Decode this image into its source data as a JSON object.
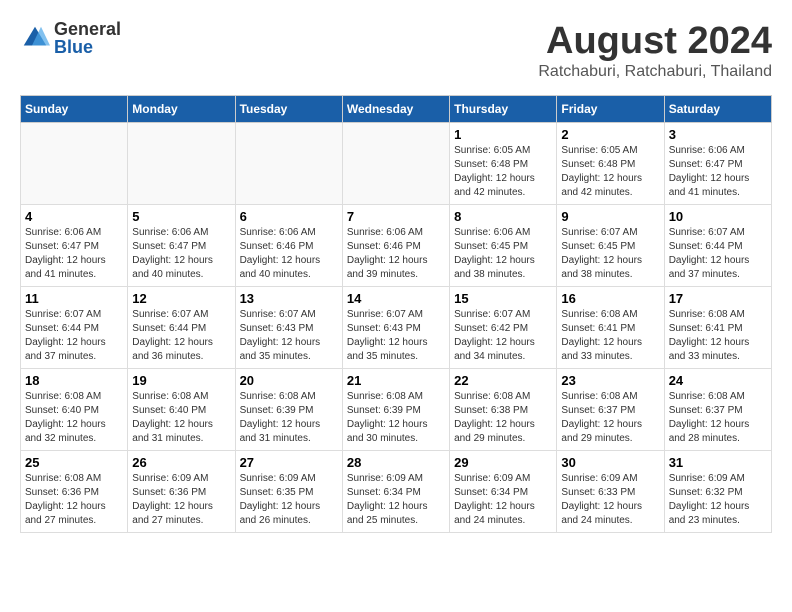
{
  "logo": {
    "general": "General",
    "blue": "Blue"
  },
  "title": "August 2024",
  "subtitle": "Ratchaburi, Ratchaburi, Thailand",
  "weekdays": [
    "Sunday",
    "Monday",
    "Tuesday",
    "Wednesday",
    "Thursday",
    "Friday",
    "Saturday"
  ],
  "weeks": [
    [
      {
        "day": "",
        "info": ""
      },
      {
        "day": "",
        "info": ""
      },
      {
        "day": "",
        "info": ""
      },
      {
        "day": "",
        "info": ""
      },
      {
        "day": "1",
        "info": "Sunrise: 6:05 AM\nSunset: 6:48 PM\nDaylight: 12 hours\nand 42 minutes."
      },
      {
        "day": "2",
        "info": "Sunrise: 6:05 AM\nSunset: 6:48 PM\nDaylight: 12 hours\nand 42 minutes."
      },
      {
        "day": "3",
        "info": "Sunrise: 6:06 AM\nSunset: 6:47 PM\nDaylight: 12 hours\nand 41 minutes."
      }
    ],
    [
      {
        "day": "4",
        "info": "Sunrise: 6:06 AM\nSunset: 6:47 PM\nDaylight: 12 hours\nand 41 minutes."
      },
      {
        "day": "5",
        "info": "Sunrise: 6:06 AM\nSunset: 6:47 PM\nDaylight: 12 hours\nand 40 minutes."
      },
      {
        "day": "6",
        "info": "Sunrise: 6:06 AM\nSunset: 6:46 PM\nDaylight: 12 hours\nand 40 minutes."
      },
      {
        "day": "7",
        "info": "Sunrise: 6:06 AM\nSunset: 6:46 PM\nDaylight: 12 hours\nand 39 minutes."
      },
      {
        "day": "8",
        "info": "Sunrise: 6:06 AM\nSunset: 6:45 PM\nDaylight: 12 hours\nand 38 minutes."
      },
      {
        "day": "9",
        "info": "Sunrise: 6:07 AM\nSunset: 6:45 PM\nDaylight: 12 hours\nand 38 minutes."
      },
      {
        "day": "10",
        "info": "Sunrise: 6:07 AM\nSunset: 6:44 PM\nDaylight: 12 hours\nand 37 minutes."
      }
    ],
    [
      {
        "day": "11",
        "info": "Sunrise: 6:07 AM\nSunset: 6:44 PM\nDaylight: 12 hours\nand 37 minutes."
      },
      {
        "day": "12",
        "info": "Sunrise: 6:07 AM\nSunset: 6:44 PM\nDaylight: 12 hours\nand 36 minutes."
      },
      {
        "day": "13",
        "info": "Sunrise: 6:07 AM\nSunset: 6:43 PM\nDaylight: 12 hours\nand 35 minutes."
      },
      {
        "day": "14",
        "info": "Sunrise: 6:07 AM\nSunset: 6:43 PM\nDaylight: 12 hours\nand 35 minutes."
      },
      {
        "day": "15",
        "info": "Sunrise: 6:07 AM\nSunset: 6:42 PM\nDaylight: 12 hours\nand 34 minutes."
      },
      {
        "day": "16",
        "info": "Sunrise: 6:08 AM\nSunset: 6:41 PM\nDaylight: 12 hours\nand 33 minutes."
      },
      {
        "day": "17",
        "info": "Sunrise: 6:08 AM\nSunset: 6:41 PM\nDaylight: 12 hours\nand 33 minutes."
      }
    ],
    [
      {
        "day": "18",
        "info": "Sunrise: 6:08 AM\nSunset: 6:40 PM\nDaylight: 12 hours\nand 32 minutes."
      },
      {
        "day": "19",
        "info": "Sunrise: 6:08 AM\nSunset: 6:40 PM\nDaylight: 12 hours\nand 31 minutes."
      },
      {
        "day": "20",
        "info": "Sunrise: 6:08 AM\nSunset: 6:39 PM\nDaylight: 12 hours\nand 31 minutes."
      },
      {
        "day": "21",
        "info": "Sunrise: 6:08 AM\nSunset: 6:39 PM\nDaylight: 12 hours\nand 30 minutes."
      },
      {
        "day": "22",
        "info": "Sunrise: 6:08 AM\nSunset: 6:38 PM\nDaylight: 12 hours\nand 29 minutes."
      },
      {
        "day": "23",
        "info": "Sunrise: 6:08 AM\nSunset: 6:37 PM\nDaylight: 12 hours\nand 29 minutes."
      },
      {
        "day": "24",
        "info": "Sunrise: 6:08 AM\nSunset: 6:37 PM\nDaylight: 12 hours\nand 28 minutes."
      }
    ],
    [
      {
        "day": "25",
        "info": "Sunrise: 6:08 AM\nSunset: 6:36 PM\nDaylight: 12 hours\nand 27 minutes."
      },
      {
        "day": "26",
        "info": "Sunrise: 6:09 AM\nSunset: 6:36 PM\nDaylight: 12 hours\nand 27 minutes."
      },
      {
        "day": "27",
        "info": "Sunrise: 6:09 AM\nSunset: 6:35 PM\nDaylight: 12 hours\nand 26 minutes."
      },
      {
        "day": "28",
        "info": "Sunrise: 6:09 AM\nSunset: 6:34 PM\nDaylight: 12 hours\nand 25 minutes."
      },
      {
        "day": "29",
        "info": "Sunrise: 6:09 AM\nSunset: 6:34 PM\nDaylight: 12 hours\nand 24 minutes."
      },
      {
        "day": "30",
        "info": "Sunrise: 6:09 AM\nSunset: 6:33 PM\nDaylight: 12 hours\nand 24 minutes."
      },
      {
        "day": "31",
        "info": "Sunrise: 6:09 AM\nSunset: 6:32 PM\nDaylight: 12 hours\nand 23 minutes."
      }
    ]
  ]
}
